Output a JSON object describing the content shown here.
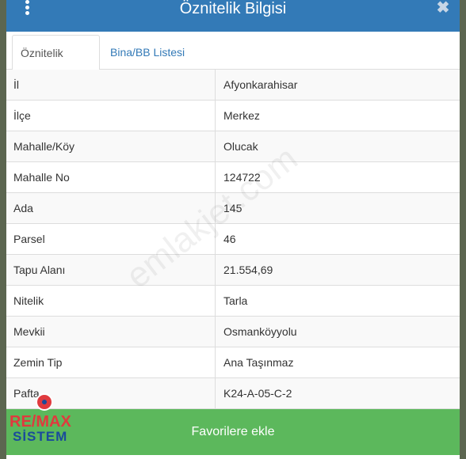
{
  "header": {
    "title": "Öznitelik Bilgisi",
    "menu_icon": "kebab-menu-icon",
    "close_icon": "close-icon",
    "close_glyph": "✖"
  },
  "tabs": [
    {
      "label": "Öznitelik Bilgisi",
      "active": true
    },
    {
      "label": "Bina/BB Listesi",
      "active": false
    }
  ],
  "attributes": [
    {
      "key": "İl",
      "value": "Afyonkarahisar"
    },
    {
      "key": "İlçe",
      "value": "Merkez"
    },
    {
      "key": "Mahalle/Köy",
      "value": "Olucak"
    },
    {
      "key": "Mahalle No",
      "value": "124722"
    },
    {
      "key": "Ada",
      "value": "145"
    },
    {
      "key": "Parsel",
      "value": "46"
    },
    {
      "key": "Tapu Alanı",
      "value": "21.554,69"
    },
    {
      "key": "Nitelik",
      "value": "Tarla"
    },
    {
      "key": "Mevkii",
      "value": "Osmanköyyolu"
    },
    {
      "key": "Zemin Tip",
      "value": "Ana Taşınmaz"
    },
    {
      "key": "Pafta",
      "value": "K24-A-05-C-2"
    }
  ],
  "footer": {
    "favorite_label": "Favorilere ekle"
  },
  "watermark": {
    "text": "emlakjet.com"
  },
  "logo": {
    "line1": "RE/MAX",
    "line2": "SİSTEM"
  },
  "colors": {
    "header": "#337ab7",
    "button": "#5cb85c",
    "tab_link": "#337ab7"
  }
}
